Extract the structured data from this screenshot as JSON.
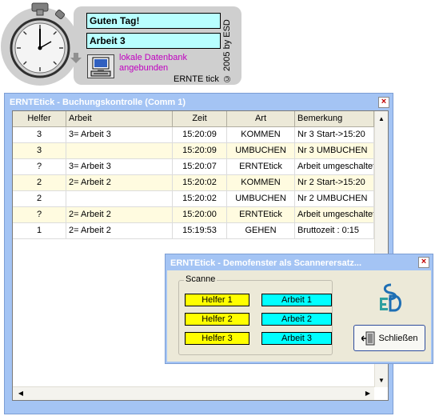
{
  "widget": {
    "greeting": "Guten Tag!",
    "task": "Arbeit  3",
    "db_status_line1": "lokale Datenbank",
    "db_status_line2": "angebunden",
    "app_name": "ERNTE tick",
    "copyright": "© 2005 by ESD"
  },
  "main_window": {
    "title": "ERNTEtick - Buchungskontrolle (Comm 1)",
    "close_label": "×",
    "columns": [
      "Helfer",
      "Arbeit",
      "Zeit",
      "Art",
      "Bemerkung"
    ],
    "rows": [
      {
        "helfer": "3",
        "arbeit": "3= Arbeit  3",
        "zeit": "15:20:09",
        "art": "KOMMEN",
        "bemerkung": "Nr 3 Start->15:20"
      },
      {
        "helfer": "3",
        "arbeit": "",
        "zeit": "15:20:09",
        "art": "UMBUCHEN",
        "bemerkung": "Nr 3 UMBUCHEN"
      },
      {
        "helfer": "?",
        "arbeit": "3= Arbeit  3",
        "zeit": "15:20:07",
        "art": "ERNTEtick",
        "bemerkung": "Arbeit umgeschaltet"
      },
      {
        "helfer": "2",
        "arbeit": "2= Arbeit  2",
        "zeit": "15:20:02",
        "art": "KOMMEN",
        "bemerkung": "Nr 2 Start->15:20"
      },
      {
        "helfer": "2",
        "arbeit": "",
        "zeit": "15:20:02",
        "art": "UMBUCHEN",
        "bemerkung": "Nr 2 UMBUCHEN"
      },
      {
        "helfer": "?",
        "arbeit": "2= Arbeit  2",
        "zeit": "15:20:00",
        "art": "ERNTEtick",
        "bemerkung": "Arbeit umgeschaltet"
      },
      {
        "helfer": "1",
        "arbeit": "2= Arbeit  2",
        "zeit": "15:19:53",
        "art": "GEHEN",
        "bemerkung": "Bruttozeit : 0:15"
      }
    ]
  },
  "demo_window": {
    "title": "ERNTEtick - Demofenster als Scannerersatz...",
    "close_label": "×",
    "group_label": "Scanne",
    "helfer_buttons": [
      "Helfer 1",
      "Helfer 2",
      "Helfer 3"
    ],
    "arbeit_buttons": [
      "Arbeit 1",
      "Arbeit 2",
      "Arbeit 3"
    ],
    "close_button": "Schließen"
  },
  "colors": {
    "titlebar": "#a4c4f4",
    "helfer_button": "#ffff00",
    "arbeit_button": "#00ffff",
    "info_field": "#b8ffff",
    "db_status_text": "#c000c0"
  }
}
